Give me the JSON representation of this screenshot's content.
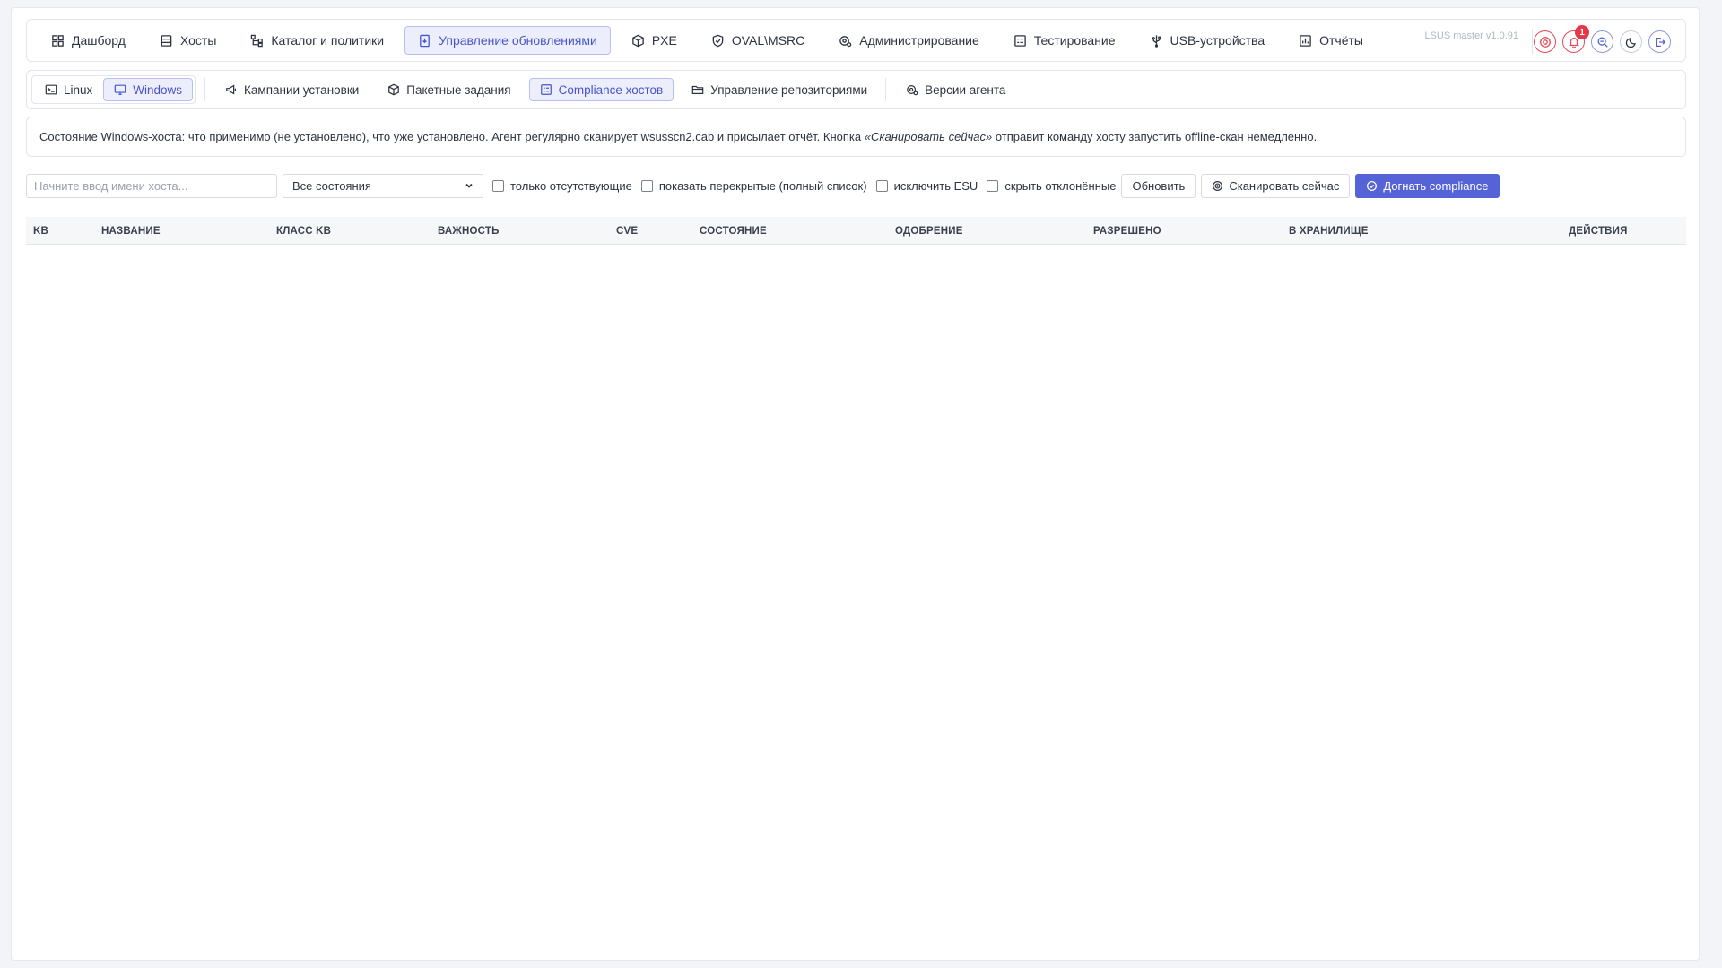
{
  "nav": {
    "items": [
      {
        "label": "Дашборд",
        "icon": "grid-icon"
      },
      {
        "label": "Хосты",
        "icon": "server-icon"
      },
      {
        "label": "Каталог и политики",
        "icon": "tree-icon"
      },
      {
        "label": "Управление обновлениями",
        "icon": "update-doc-icon",
        "active": true
      },
      {
        "label": "PXE",
        "icon": "box-icon"
      },
      {
        "label": "OVAL\\MSRC",
        "icon": "shield-icon"
      },
      {
        "label": "Администрирование",
        "icon": "admin-gear-icon"
      },
      {
        "label": "Тестирование",
        "icon": "test-list-icon"
      },
      {
        "label": "USB-устройства",
        "icon": "usb-icon"
      },
      {
        "label": "Отчёты",
        "icon": "report-icon"
      }
    ],
    "version": "LSUS master v1.0.91",
    "notification_count": "1"
  },
  "subnav": {
    "os_toggle": [
      {
        "label": "Linux",
        "icon": "terminal-icon"
      },
      {
        "label": "Windows",
        "icon": "monitor-icon",
        "active": true
      }
    ],
    "items": [
      {
        "label": "Кампании установки",
        "icon": "megaphone-icon"
      },
      {
        "label": "Пакетные задания",
        "icon": "package-icon"
      },
      {
        "label": "Compliance хостов",
        "icon": "compliance-icon",
        "active": true
      },
      {
        "label": "Управление репозиториями",
        "icon": "folder-icon"
      }
    ],
    "agent_versions": {
      "label": "Версии агента",
      "icon": "agent-gear-icon"
    }
  },
  "info": {
    "text_before": "Состояние Windows-хоста: что применимо (не установлено), что уже установлено. Агент регулярно сканирует wsusscn2.cab и присылает отчёт. Кнопка ",
    "text_em": "«Сканировать сейчас»",
    "text_after": " отправит команду хосту запустить offline-скан немедленно."
  },
  "filters": {
    "host_placeholder": "Начните ввод имени хоста...",
    "state_select": "Все состояния",
    "only_missing": "только отсутствующие",
    "show_superseded": "показать перекрытые (полный список)",
    "exclude_esu": "исключить ESU",
    "hide_declined": "скрыть отклонённые",
    "refresh": "Обновить",
    "scan_now": "Сканировать сейчас",
    "catch_up": "Догнать compliance"
  },
  "table": {
    "columns": [
      "KB",
      "НАЗВАНИЕ",
      "КЛАСС KB",
      "ВАЖНОСТЬ",
      "CVE",
      "СОСТОЯНИЕ",
      "ОДОБРЕНИЕ",
      "РАЗРЕШЕНО",
      "В ХРАНИЛИЩЕ",
      "ДЕЙСТВИЯ"
    ]
  },
  "colors": {
    "accent": "#5563d6",
    "active_bg": "#eceefc",
    "badge": "#e5384a"
  }
}
